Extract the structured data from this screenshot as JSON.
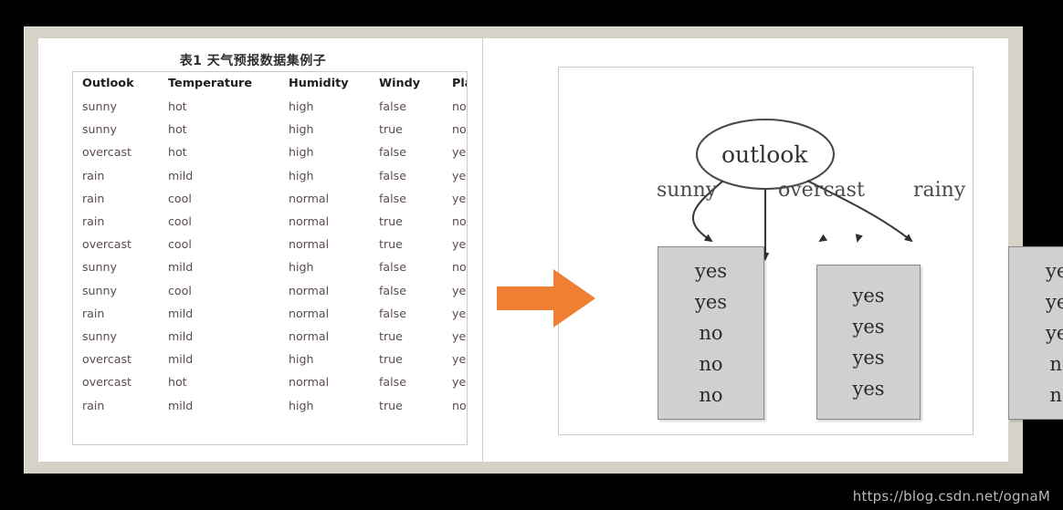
{
  "slide": {
    "frame_color": "#d6d2c8",
    "canvas_color": "#ffffff",
    "background_color": "#000000"
  },
  "left_pane": {
    "caption": "表1 天气预报数据集例子",
    "table": {
      "columns": [
        "Outlook",
        "Temperature",
        "Humidity",
        "Windy",
        "Play?"
      ],
      "rows": [
        [
          "sunny",
          "hot",
          "high",
          "false",
          "no"
        ],
        [
          "sunny",
          "hot",
          "high",
          "true",
          "no"
        ],
        [
          "overcast",
          "hot",
          "high",
          "false",
          "yes"
        ],
        [
          "rain",
          "mild",
          "high",
          "false",
          "yes"
        ],
        [
          "rain",
          "cool",
          "normal",
          "false",
          "yes"
        ],
        [
          "rain",
          "cool",
          "normal",
          "true",
          "no"
        ],
        [
          "overcast",
          "cool",
          "normal",
          "true",
          "yes"
        ],
        [
          "sunny",
          "mild",
          "high",
          "false",
          "no"
        ],
        [
          "sunny",
          "cool",
          "normal",
          "false",
          "yes"
        ],
        [
          "rain",
          "mild",
          "normal",
          "false",
          "yes"
        ],
        [
          "sunny",
          "mild",
          "normal",
          "true",
          "yes"
        ],
        [
          "overcast",
          "mild",
          "high",
          "true",
          "yes"
        ],
        [
          "overcast",
          "hot",
          "normal",
          "false",
          "yes"
        ],
        [
          "rain",
          "mild",
          "high",
          "true",
          "no"
        ]
      ]
    }
  },
  "arrow": {
    "name": "orange-right-arrow",
    "color": "#ef8033"
  },
  "right_pane": {
    "tree": {
      "root": {
        "label": "outlook",
        "shape": "ellipse"
      },
      "branches": [
        {
          "label": "sunny",
          "leaf_values": [
            "yes",
            "yes",
            "no",
            "no",
            "no"
          ]
        },
        {
          "label": "overcast",
          "leaf_values": [
            "yes",
            "yes",
            "yes",
            "yes"
          ]
        },
        {
          "label": "rainy",
          "leaf_values": [
            "yes",
            "yes",
            "yes",
            "no",
            "no"
          ]
        }
      ]
    }
  },
  "watermark": {
    "text": "https://blog.csdn.net/ognaM"
  }
}
